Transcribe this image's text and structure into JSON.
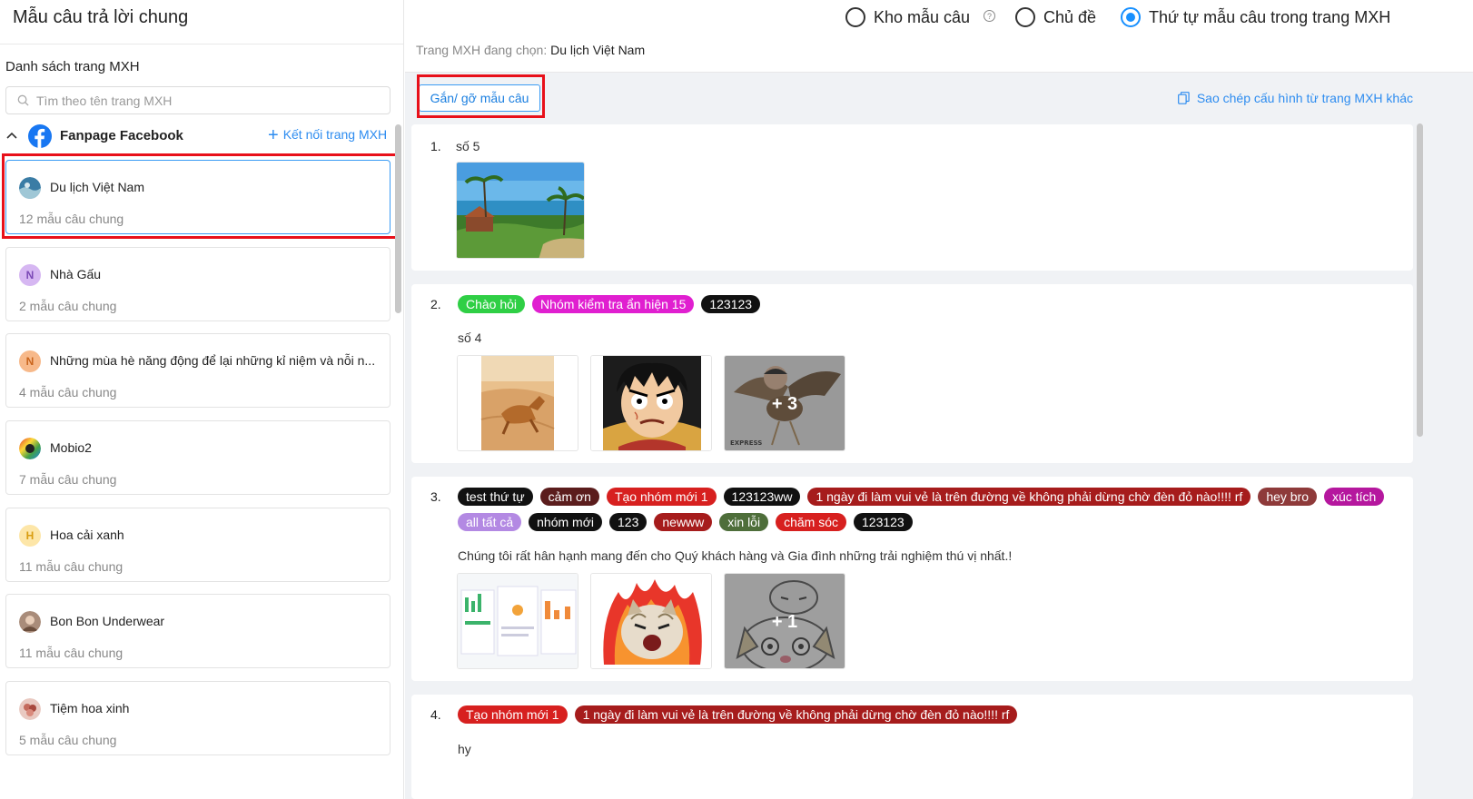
{
  "left": {
    "title": "Mẫu câu trả lời chung",
    "list_label": "Danh sách trang MXH",
    "search_placeholder": "Tìm theo tên trang MXH",
    "group": {
      "name": "Fanpage Facebook",
      "connect_label": "Kết nối trang MXH"
    },
    "pages": [
      {
        "name": "Du lịch Việt Nam",
        "count": "12 mẫu câu chung",
        "avatar_letter": "",
        "avatar_color": "#3a7ca5"
      },
      {
        "name": "Nhà Gấu",
        "count": "2 mẫu câu chung",
        "avatar_letter": "N",
        "avatar_color": "#d6b7f2"
      },
      {
        "name": "Những mùa hè năng động để lại những kỉ niệm và nỗi n...",
        "count": "4 mẫu câu chung",
        "avatar_letter": "N",
        "avatar_color": "#f7b98a"
      },
      {
        "name": "Mobio2",
        "count": "7 mẫu câu chung",
        "avatar_letter": "",
        "avatar_color": "#222222"
      },
      {
        "name": "Hoa cải xanh",
        "count": "11 mẫu câu chung",
        "avatar_letter": "H",
        "avatar_color": "#fde6a8"
      },
      {
        "name": "Bon Bon Underwear",
        "count": "11 mẫu câu chung",
        "avatar_letter": "",
        "avatar_color": "#a98c7a"
      },
      {
        "name": "Tiệm hoa xinh",
        "count": "5 mẫu câu chung",
        "avatar_letter": "",
        "avatar_color": "#c46a5c"
      }
    ]
  },
  "right": {
    "radios": [
      {
        "label": "Kho mẫu câu",
        "active": false,
        "help": "?"
      },
      {
        "label": "Chủ đề",
        "active": false
      },
      {
        "label": "Thứ tự mẫu câu trong trang MXH",
        "active": true
      }
    ],
    "current_label": "Trang MXH đang chọn:",
    "current_value": "Du lịch Việt Nam",
    "attach_button": "Gắn/ gỡ mẫu câu",
    "copy_config": "Sao chép cấu hình từ trang MXH khác",
    "items": [
      {
        "num": "1.",
        "tags": [],
        "text": "số 5",
        "thumbs": [
          "beach"
        ],
        "more": ""
      },
      {
        "num": "2.",
        "tags": [
          {
            "label": "Chào hỏi",
            "color": "#2fcf45"
          },
          {
            "label": "Nhóm kiểm tra ẩn hiện 15",
            "color": "#e01fd0"
          },
          {
            "label": "123123",
            "color": "#111111"
          }
        ],
        "text": "số 4",
        "thumbs": [
          "dog",
          "luffy",
          "bird"
        ],
        "more": "+ 3"
      },
      {
        "num": "3.",
        "tags": [
          {
            "label": "test thứ tự",
            "color": "#111111"
          },
          {
            "label": "cảm ơn",
            "color": "#5b1d1d"
          },
          {
            "label": "Tạo nhóm mới 1",
            "color": "#d7201f"
          },
          {
            "label": "123123ww",
            "color": "#111111"
          },
          {
            "label": "1 ngày đi làm vui vẻ là trên đường về không phải dừng chờ đèn đỏ nào!!!! rf",
            "color": "#a61c1c"
          },
          {
            "label": "hey bro",
            "color": "#8e3a3a"
          },
          {
            "label": "xúc tích",
            "color": "#b5179e"
          },
          {
            "label": "all tất cả",
            "color": "#b389e3"
          },
          {
            "label": "nhóm mới",
            "color": "#111111"
          },
          {
            "label": "123",
            "color": "#111111"
          },
          {
            "label": "newww",
            "color": "#a61c1c"
          },
          {
            "label": "xin lỗi",
            "color": "#4e6e3a"
          },
          {
            "label": "chăm sóc",
            "color": "#d7201f"
          },
          {
            "label": "123123",
            "color": "#111111"
          }
        ],
        "text": "Chúng tôi rất hân hạnh mang đến cho Quý khách hàng và Gia đình những trải nghiệm thú vị nhất.!",
        "thumbs": [
          "screenshot",
          "cat1",
          "cat2"
        ],
        "more": "+ 1"
      },
      {
        "num": "4.",
        "tags": [
          {
            "label": "Tạo nhóm mới 1",
            "color": "#d7201f"
          },
          {
            "label": "1 ngày đi làm vui vẻ là trên đường về không phải dừng chờ đèn đỏ nào!!!! rf",
            "color": "#a61c1c"
          }
        ],
        "text": "hy",
        "thumbs": [],
        "more": ""
      }
    ]
  }
}
